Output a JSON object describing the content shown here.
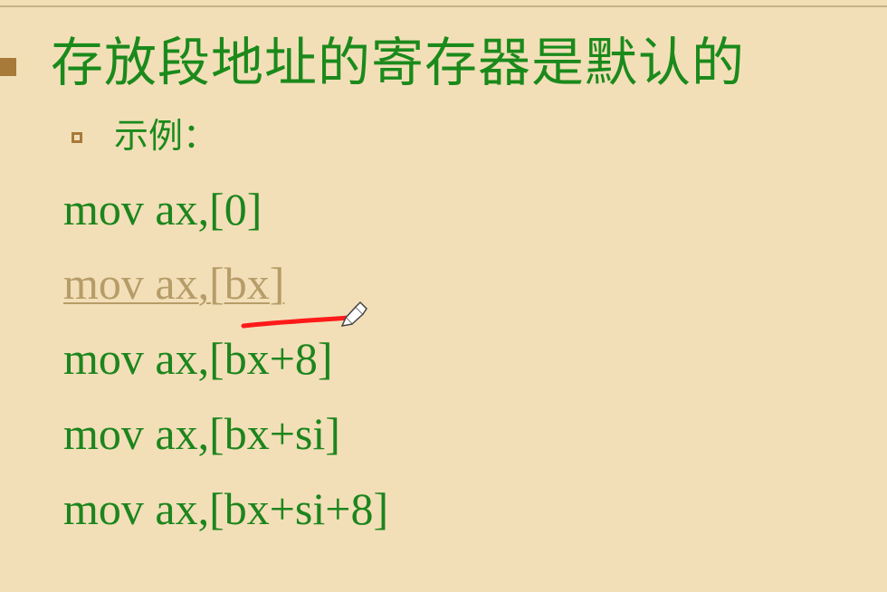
{
  "slide": {
    "heading": "存放段地址的寄存器是默认的",
    "subheading": "示例：",
    "examples": [
      "mov ax,[0]",
      "mov ax,[bx]",
      "mov ax,[bx+8]",
      "mov ax,[bx+si]",
      "mov ax,[bx+si+8]"
    ]
  },
  "icons": {
    "main_bullet": "square-bullet-icon",
    "sub_bullet": "hollow-square-bullet-icon",
    "pen": "pen-icon"
  },
  "colors": {
    "background": "#f2dfb8",
    "text_primary": "#1d851d",
    "highlighted_text": "#b69c68",
    "annotation": "#ff1a1a",
    "bullet": "#a77a3a"
  }
}
